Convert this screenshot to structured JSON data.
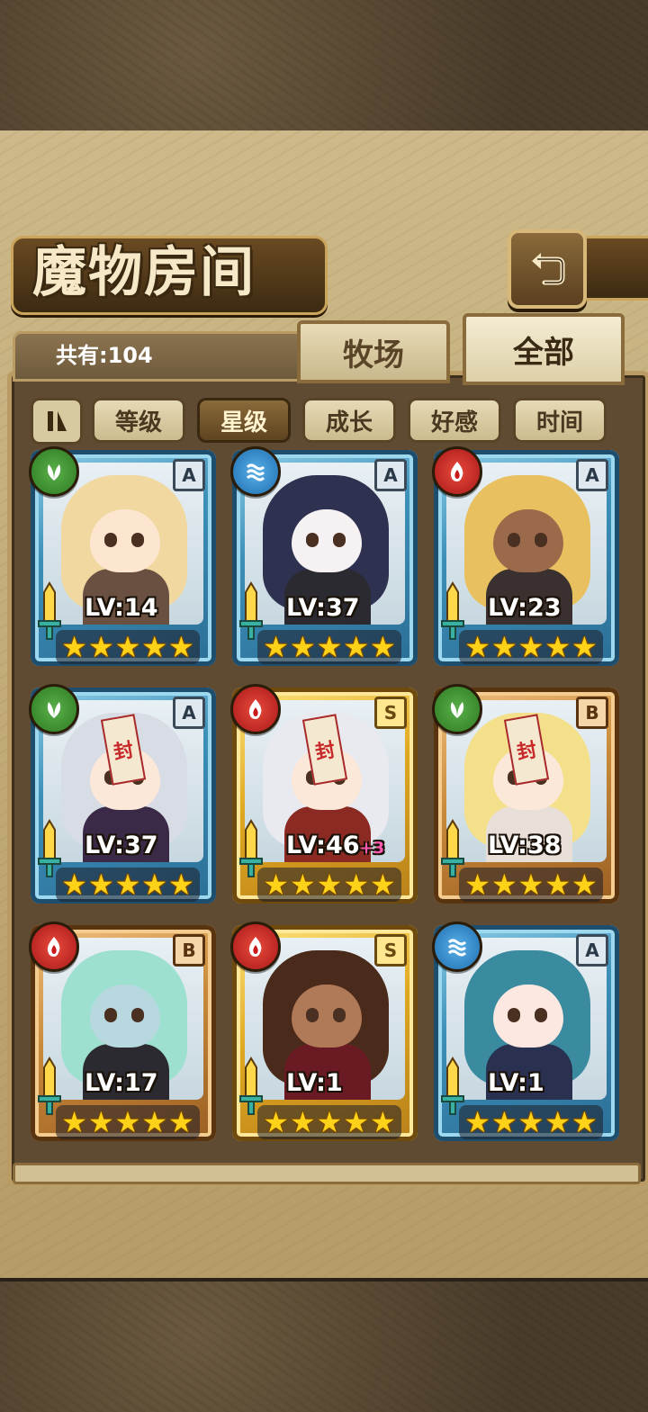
{
  "header": {
    "title": "魔物房间",
    "back_icon": "return-arrow-icon"
  },
  "summary": {
    "count_label": "共有:104"
  },
  "tabs": [
    {
      "label": "牧场",
      "active": false
    },
    {
      "label": "全部",
      "active": true
    }
  ],
  "sort": {
    "toggle_icon": "pause-bars-icon",
    "buttons": [
      {
        "label": "等级",
        "active": false
      },
      {
        "label": "星级",
        "active": true
      },
      {
        "label": "成长",
        "active": false
      },
      {
        "label": "好感",
        "active": false
      },
      {
        "label": "时间",
        "active": false
      }
    ]
  },
  "monsters": [
    {
      "level": "LV:14",
      "bonus": "",
      "element": "wood",
      "rank": "A",
      "frame": "blue",
      "stars": 5,
      "tagged": false,
      "hair": "#f0d8a0",
      "skin": "#fde6d0",
      "outfit": "#6a5040"
    },
    {
      "level": "LV:37",
      "bonus": "",
      "element": "water",
      "rank": "A",
      "frame": "blue",
      "stars": 5,
      "tagged": false,
      "hair": "#2e3250",
      "skin": "#f6f2f4",
      "outfit": "#2a2a30"
    },
    {
      "level": "LV:23",
      "bonus": "",
      "element": "fire",
      "rank": "A",
      "frame": "blue",
      "stars": 5,
      "tagged": false,
      "hair": "#e8c060",
      "skin": "#9a6a4a",
      "outfit": "#3a3030"
    },
    {
      "level": "LV:37",
      "bonus": "",
      "element": "wood",
      "rank": "A",
      "frame": "blue",
      "stars": 5,
      "tagged": true,
      "hair": "#d8dce4",
      "skin": "#fce8d8",
      "outfit": "#3a2a48"
    },
    {
      "level": "LV:46",
      "bonus": "+3",
      "element": "fire",
      "rank": "S",
      "frame": "gold",
      "stars": 5,
      "tagged": true,
      "hair": "#e8eaf0",
      "skin": "#fce8d8",
      "outfit": "#8a2a22"
    },
    {
      "level": "LV:38",
      "bonus": "",
      "element": "wood",
      "rank": "B",
      "frame": "bronze",
      "stars": 5,
      "tagged": true,
      "hair": "#f4e08a",
      "skin": "#fce8d8",
      "outfit": "#e8e0d8"
    },
    {
      "level": "LV:17",
      "bonus": "",
      "element": "fire",
      "rank": "B",
      "frame": "bronze",
      "stars": 5,
      "tagged": false,
      "hair": "#9ee0d0",
      "skin": "#b8d8e0",
      "outfit": "#2a2a30"
    },
    {
      "level": "LV:1",
      "bonus": "",
      "element": "fire",
      "rank": "S",
      "frame": "gold",
      "stars": 5,
      "tagged": false,
      "hair": "#4a2a1a",
      "skin": "#b07a58",
      "outfit": "#6a1a22"
    },
    {
      "level": "LV:1",
      "bonus": "",
      "element": "water",
      "rank": "A",
      "frame": "blue",
      "stars": 5,
      "tagged": false,
      "hair": "#3a8aa0",
      "skin": "#fce8e0",
      "outfit": "#2a3050"
    }
  ],
  "tag_glyph": "封"
}
